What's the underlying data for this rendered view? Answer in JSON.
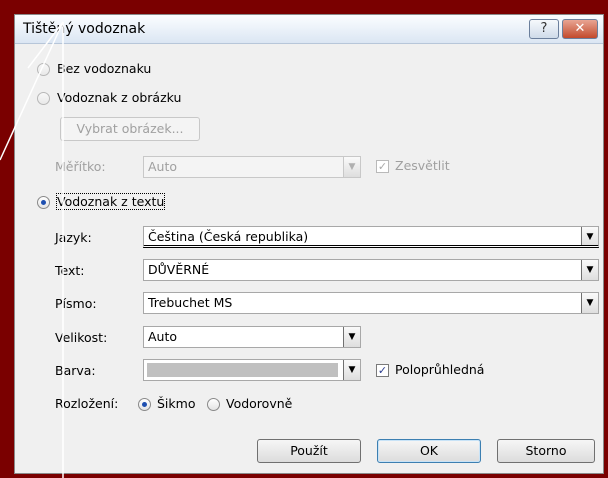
{
  "dialog": {
    "title": "Tištěný vodoznak",
    "help_label": "?",
    "close_label": "✕"
  },
  "options": {
    "no_watermark": "Bez vodoznaku",
    "picture_watermark": "Vodoznak z obrázku",
    "select_picture": "Vybrat obrázek...",
    "scale_label": "Měřítko:",
    "scale_value": "Auto",
    "washout_label": "Zesvětlit",
    "text_watermark": "Vodoznak z textu",
    "language_label": "Jazyk:",
    "language_value": "Čeština (Česká republika)",
    "text_label": "Text:",
    "text_value": "DŮVĚRNÉ",
    "font_label": "Písmo:",
    "font_value": "Trebuchet MS",
    "size_label": "Velikost:",
    "size_value": "Auto",
    "color_label": "Barva:",
    "color_value": "",
    "semitransparent_label": "Poloprůhledná",
    "layout_label": "Rozložení:",
    "diagonal_label": "Šikmo",
    "horizontal_label": "Vodorovně"
  },
  "buttons": {
    "apply": "Použít",
    "ok": "OK",
    "cancel": "Storno"
  },
  "state": {
    "selected_option": "Vodoznak z textu",
    "washout_checked": true,
    "semitransparent_checked": true,
    "layout_selected": "Šikmo"
  },
  "colors": {
    "background": "#7a0000",
    "color_swatch": "#c0c0c0"
  }
}
